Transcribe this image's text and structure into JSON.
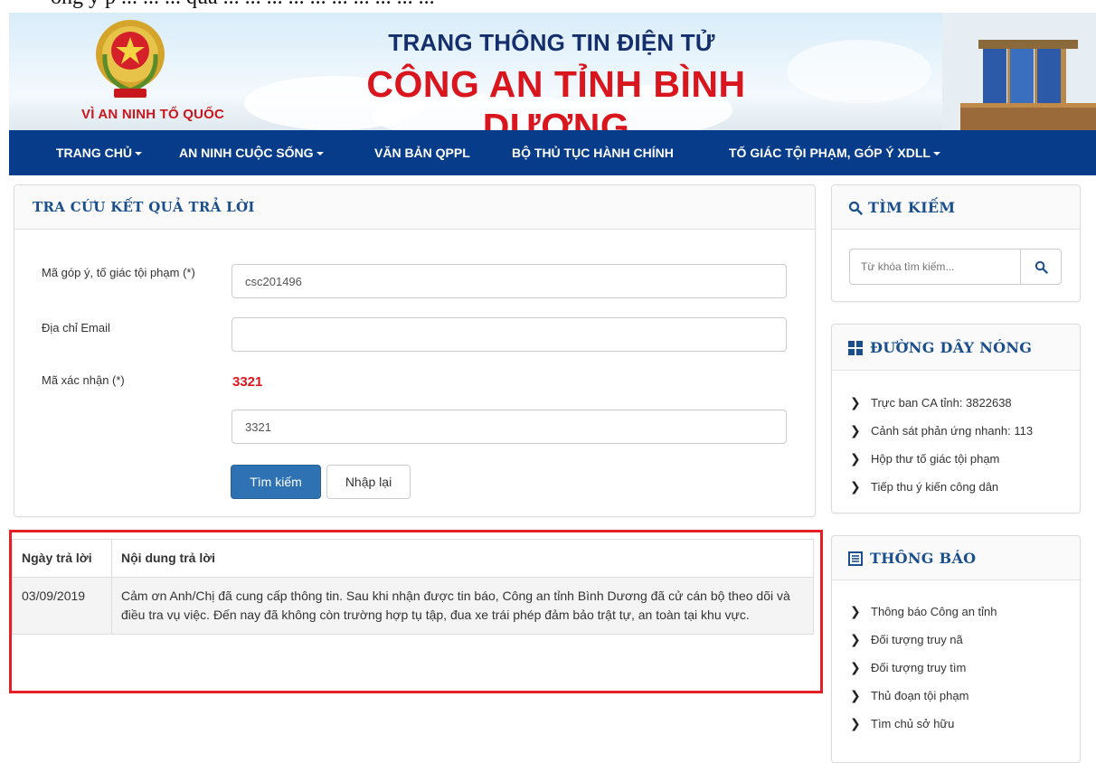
{
  "header": {
    "motto": "VÌ AN NINH TỔ QUỐC",
    "title_line1": "TRANG THÔNG TIN ĐIỆN TỬ",
    "title_line2": "CÔNG AN TỈNH BÌNH DƯƠNG"
  },
  "nav": {
    "items": [
      {
        "label": "TRANG CHỦ"
      },
      {
        "label": "AN NINH CUỘC SỐNG"
      },
      {
        "label": "VĂN BẢN QPPL"
      },
      {
        "label": "BỘ THỦ TỤC HÀNH CHÍNH"
      },
      {
        "label": "TỐ GIÁC TỘI PHẠM, GÓP Ý XDLL"
      }
    ]
  },
  "lookup": {
    "title": "TRA CỨU KẾT QUẢ TRẢ LỜI",
    "code_label": "Mã góp ý, tố giác tội phạm (*)",
    "code_value": "csc201496",
    "email_label": "Địa chỉ Email",
    "email_value": "",
    "captcha_label": "Mã xác nhận (*)",
    "captcha_code": "3321",
    "captcha_value": "3321",
    "search_button": "Tìm kiếm",
    "reset_button": "Nhập lại"
  },
  "results": {
    "headers": [
      "Ngày trả lời",
      "Nội dung trả lời"
    ],
    "rows": [
      {
        "date": "03/09/2019",
        "content": "Cảm ơn Anh/Chị đã cung cấp thông tin. Sau khi nhận được tin báo, Công an tỉnh Bình Dương đã cử cán bộ theo dõi và điều tra vụ việc. Đến nay đã không còn trường hợp tụ tập, đua xe trái phép đảm bảo trật tự, an toàn tại khu vực."
      }
    ]
  },
  "sidebar": {
    "search": {
      "title": "TÌM KIẾM",
      "placeholder": "Từ khóa tìm kiếm..."
    },
    "hotline": {
      "title": "ĐƯỜNG DÂY NÓNG",
      "items": [
        "Trực ban CA tỉnh: 3822638",
        "Cảnh sát phản ứng nhanh: 113",
        "Hộp thư tố giác tội phạm",
        "Tiếp thu ý kiến công dân"
      ]
    },
    "notice": {
      "title": "THÔNG BÁO",
      "items": [
        "Thông báo Công an tỉnh",
        "Đối tượng truy nã",
        "Đối tượng truy tìm",
        "Thủ đoạn tội phạm",
        "Tìm chủ sở hữu"
      ]
    }
  },
  "colors": {
    "nav_bg": "#063c8a",
    "title_red": "#d9161e",
    "title_blue": "#142f6b",
    "highlight_border": "#e41f26",
    "primary_button": "#2f72b3"
  }
}
